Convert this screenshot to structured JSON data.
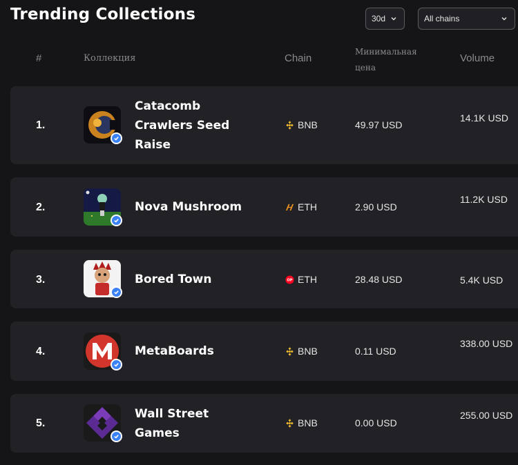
{
  "page": {
    "title": "Trending Collections"
  },
  "filters": {
    "period": "30d",
    "chains": "All chains"
  },
  "table": {
    "headers": {
      "rank": "#",
      "collection": "Коллекция",
      "chain": "Chain",
      "min_price": "Минимальная цена",
      "volume": "Volume"
    },
    "rows": [
      {
        "rank": "1.",
        "name": "Catacomb Crawlers Seed Raise",
        "chain": "BNB",
        "chain_icon": "bnb-icon",
        "min_price": "49.97 USD",
        "volume": "14.1K USD",
        "verified": true
      },
      {
        "rank": "2.",
        "name": "Nova Mushroom",
        "chain": "ETH",
        "chain_icon": "eth-network-icon",
        "min_price": "2.90 USD",
        "volume": "11.2K USD",
        "verified": true
      },
      {
        "rank": "3.",
        "name": "Bored Town",
        "chain": "ETH",
        "chain_icon": "optimism-icon",
        "min_price": "28.48 USD",
        "volume": "5.4K USD",
        "verified": true
      },
      {
        "rank": "4.",
        "name": "MetaBoards",
        "chain": "BNB",
        "chain_icon": "bnb-icon",
        "min_price": "0.11 USD",
        "volume": "338.00 USD",
        "verified": true
      },
      {
        "rank": "5.",
        "name": "Wall Street Games",
        "chain": "BNB",
        "chain_icon": "bnb-icon",
        "min_price": "0.00 USD",
        "volume": "255.00 USD",
        "verified": true
      }
    ]
  },
  "colors": {
    "background": "#151517",
    "row": "#222226",
    "accent": "#3b82f6",
    "bnb": "#f3ba2f",
    "optimism": "#ff0420"
  }
}
